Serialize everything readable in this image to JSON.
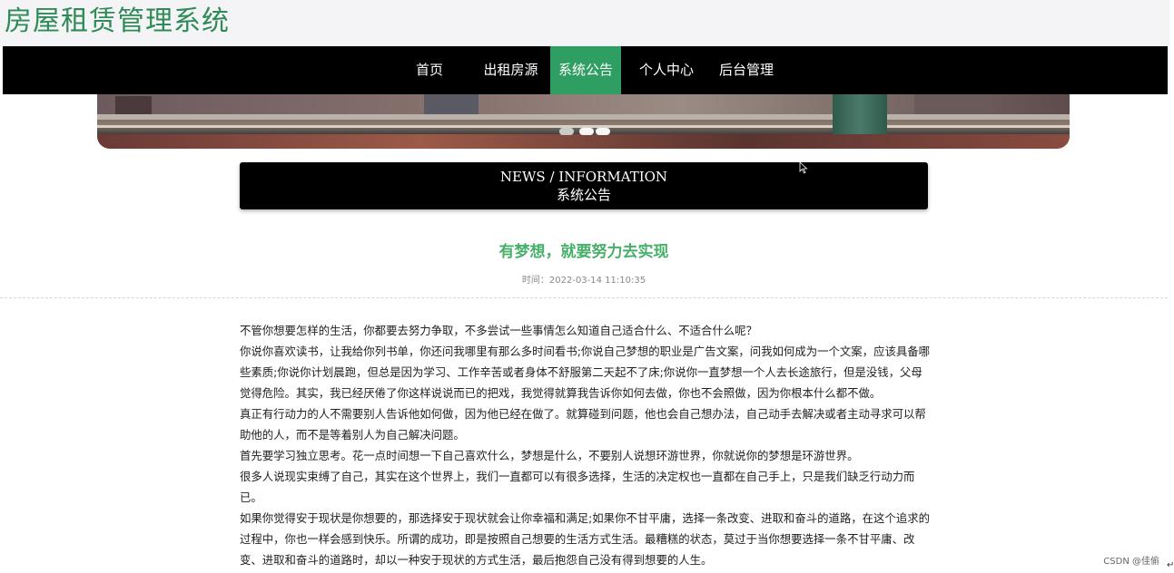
{
  "header": {
    "site_title": "房屋租赁管理系统"
  },
  "nav": {
    "items": [
      {
        "label": "首页"
      },
      {
        "label": "出租房源"
      },
      {
        "label": "系统公告"
      },
      {
        "label": "个人中心"
      },
      {
        "label": "后台管理"
      }
    ],
    "active_index": 2
  },
  "carousel": {
    "slide_count": 3,
    "active_index": 0
  },
  "section": {
    "title_en": "NEWS / INFORMATION",
    "title_zh": "系统公告"
  },
  "article": {
    "title": "有梦想，就要努力去实现",
    "time": "时间：2022-03-14 11:10:35",
    "paragraphs": [
      "不管你想要怎样的生活，你都要去努力争取，不多尝试一些事情怎么知道自己适合什么、不适合什么呢？",
      "你说你喜欢读书，让我给你列书单，你还问我哪里有那么多时间看书;你说自己梦想的职业是广告文案，问我如何成为一个文案，应该具备哪些素质;你说你计划晨跑，但总是因为学习、工作辛苦或者身体不舒服第二天起不了床;你说你一直梦想一个人去长途旅行，但是没钱，父母觉得危险。其实，我已经厌倦了你这样说说而已的把戏，我觉得就算我告诉你如何去做，你也不会照做，因为你根本什么都不做。",
      "真正有行动力的人不需要别人告诉他如何做，因为他已经在做了。就算碰到问题，他也会自己想办法，自己动手去解决或者主动寻求可以帮助他的人，而不是等着别人为自己解决问题。",
      "首先要学习独立思考。花一点时间想一下自己喜欢什么，梦想是什么，不要别人说想环游世界，你就说你的梦想是环游世界。",
      "很多人说现实束缚了自己，其实在这个世界上，我们一直都可以有很多选择，生活的决定权也一直都在自己手上，只是我们缺乏行动力而已。",
      "如果你觉得安于现状是你想要的，那选择安于现状就会让你幸福和满足;如果你不甘平庸，选择一条改变、进取和奋斗的道路，在这个追求的过程中，你也一样会感到快乐。所谓的成功，即是按照自己想要的生活方式生活。最糟糕的状态，莫过于当你想要选择一条不甘平庸、改变、进取和奋斗的道路时，却以一种安于现状的方式生活，最后抱怨自己没有得到想要的人生。"
    ]
  },
  "watermark": "CSDN @佳偷",
  "colors": {
    "brand_green": "#2e8b57",
    "nav_active": "#2f9e63",
    "title_green": "#46b06a"
  }
}
